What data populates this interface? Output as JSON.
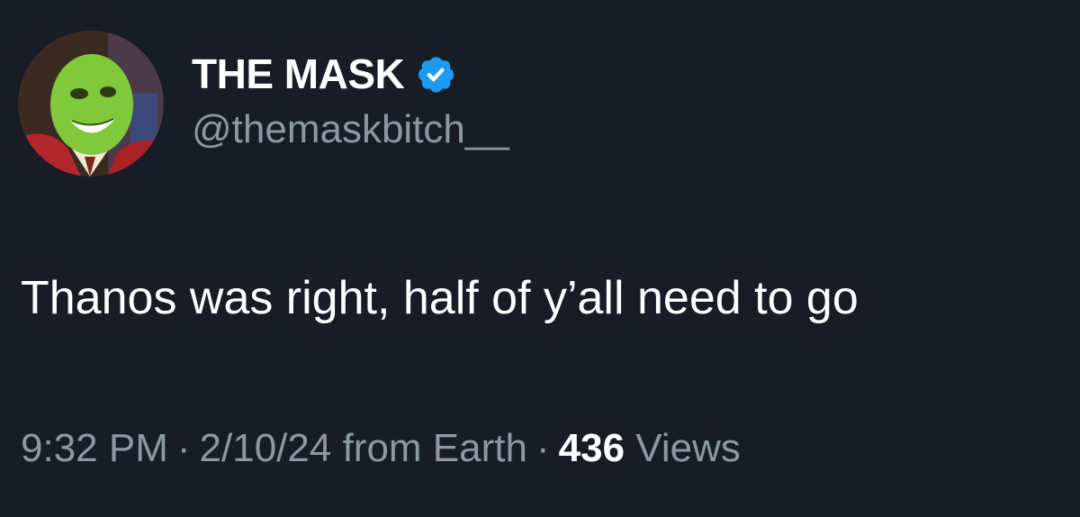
{
  "author": {
    "display_name": "THE MASK",
    "handle": "@themaskbitch__",
    "verified": true,
    "verified_icon": "verified-badge-icon",
    "verified_color": "#1d9bf0"
  },
  "tweet": {
    "text": "Thanos was right, half of y’all need to go"
  },
  "meta": {
    "time": "9:32 PM",
    "separator": "·",
    "date": "2/10/24",
    "source": "from Earth",
    "views_count": "436",
    "views_label": "Views"
  },
  "colors": {
    "background": "#171c26",
    "primary_text": "#ffffff",
    "secondary_text": "#8b98a5"
  }
}
